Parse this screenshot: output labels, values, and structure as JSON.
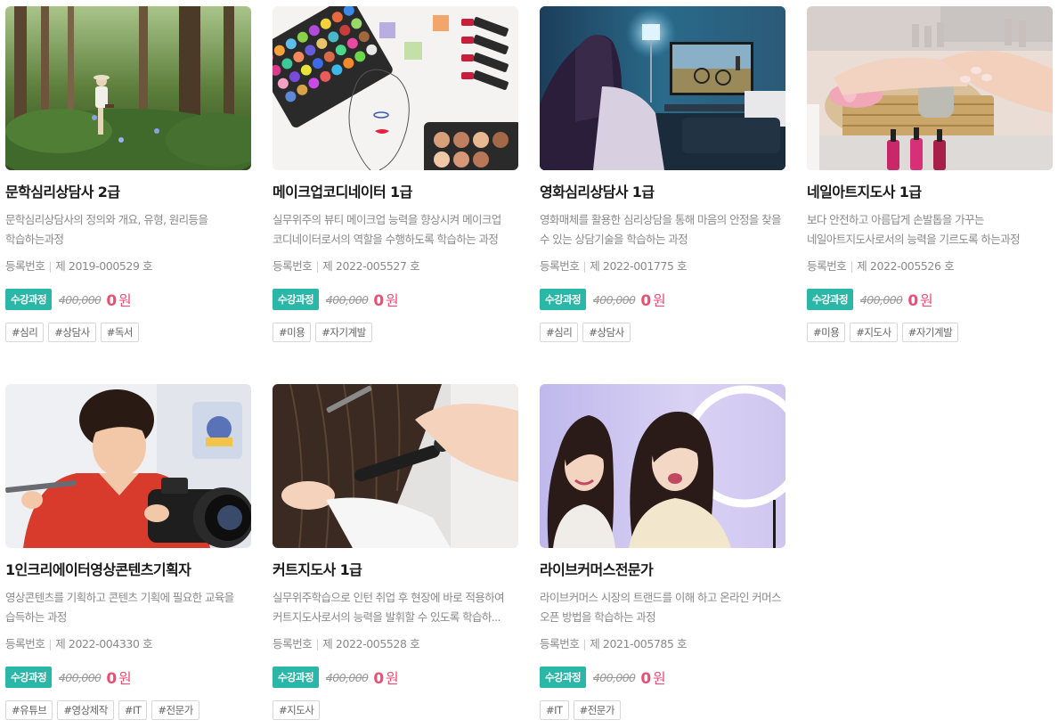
{
  "courses": [
    {
      "title": "문학심리상담사 2급",
      "description": "문학심리상담사의 정의와 개요, 유형, 원리등을 학습하는과정",
      "reg_label": "등록번호",
      "reg_no": "제 2019-000529 호",
      "badge": "수강과정",
      "original_price": "400,000",
      "price_value": "0",
      "price_unit": "원",
      "tags": [
        "#심리",
        "#상담사",
        "#독서"
      ],
      "image": "woman-reading-in-forest"
    },
    {
      "title": "메이크업코디네이터 1급",
      "description": "실무위주의 뷰티 메이크업 능력을 향상시켜 메이크업 코디네이터로서의 역할을 수행하도록 학습하는 과정",
      "reg_label": "등록번호",
      "reg_no": "제 2022-005527 호",
      "badge": "수강과정",
      "original_price": "400,000",
      "price_value": "0",
      "price_unit": "원",
      "tags": [
        "#미용",
        "#자기계발"
      ],
      "image": "makeup-palette-sketch"
    },
    {
      "title": "영화심리상담사 1급",
      "description": "영화매체를 활용한 심리상담을 통해 마음의 안정을 찾을 수 있는 상담기술을 학습하는 과정",
      "reg_label": "등록번호",
      "reg_no": "제 2022-001775 호",
      "badge": "수강과정",
      "original_price": "400,000",
      "price_value": "0",
      "price_unit": "원",
      "tags": [
        "#심리",
        "#상담사"
      ],
      "image": "woman-watching-tv"
    },
    {
      "title": "네일아트지도사 1급",
      "description": "보다 안전하고 아름답게 손발톱을 가꾸는 네일아트지도사로서의 능력을 기르도록 하는과정",
      "reg_label": "등록번호",
      "reg_no": "제 2022-005526 호",
      "badge": "수강과정",
      "original_price": "400,000",
      "price_value": "0",
      "price_unit": "원",
      "tags": [
        "#미용",
        "#지도사",
        "#자기계발"
      ],
      "image": "nail-salon-hands"
    },
    {
      "title": "1인크리에이터영상콘텐츠기획자",
      "description": "영상콘텐츠를 기획하고 콘텐츠 기획에 필요한 교육을 습득하는 과정",
      "reg_label": "등록번호",
      "reg_no": "제 2022-004330 호",
      "badge": "수강과정",
      "original_price": "400,000",
      "price_value": "0",
      "price_unit": "원",
      "tags": [
        "#유튜브",
        "#영상제작",
        "#IT",
        "#전문가"
      ],
      "image": "creator-with-camera"
    },
    {
      "title": "커트지도사 1급",
      "description": "실무위주학습으로 인턴 취업 후 현장에 바로 적용하여 커트지도사로서의 능력을 발휘할 수 있도록 학습하...",
      "reg_label": "등록번호",
      "reg_no": "제 2022-005528 호",
      "badge": "수강과정",
      "original_price": "400,000",
      "price_value": "0",
      "price_unit": "원",
      "tags": [
        "#지도사"
      ],
      "image": "hair-curling-iron"
    },
    {
      "title": "라이브커머스전문가",
      "description": "라이브커머스 시장의 트랜드를 이해 하고 온라인 커머스 오픈 방법을 학습하는 과정",
      "reg_label": "등록번호",
      "reg_no": "제 2021-005785 호",
      "badge": "수강과정",
      "original_price": "400,000",
      "price_value": "0",
      "price_unit": "원",
      "tags": [
        "#IT",
        "#전문가"
      ],
      "image": "two-women-ring-light"
    }
  ],
  "colors": {
    "badge_bg": "#2bb7a8",
    "price": "#ec4f74"
  }
}
